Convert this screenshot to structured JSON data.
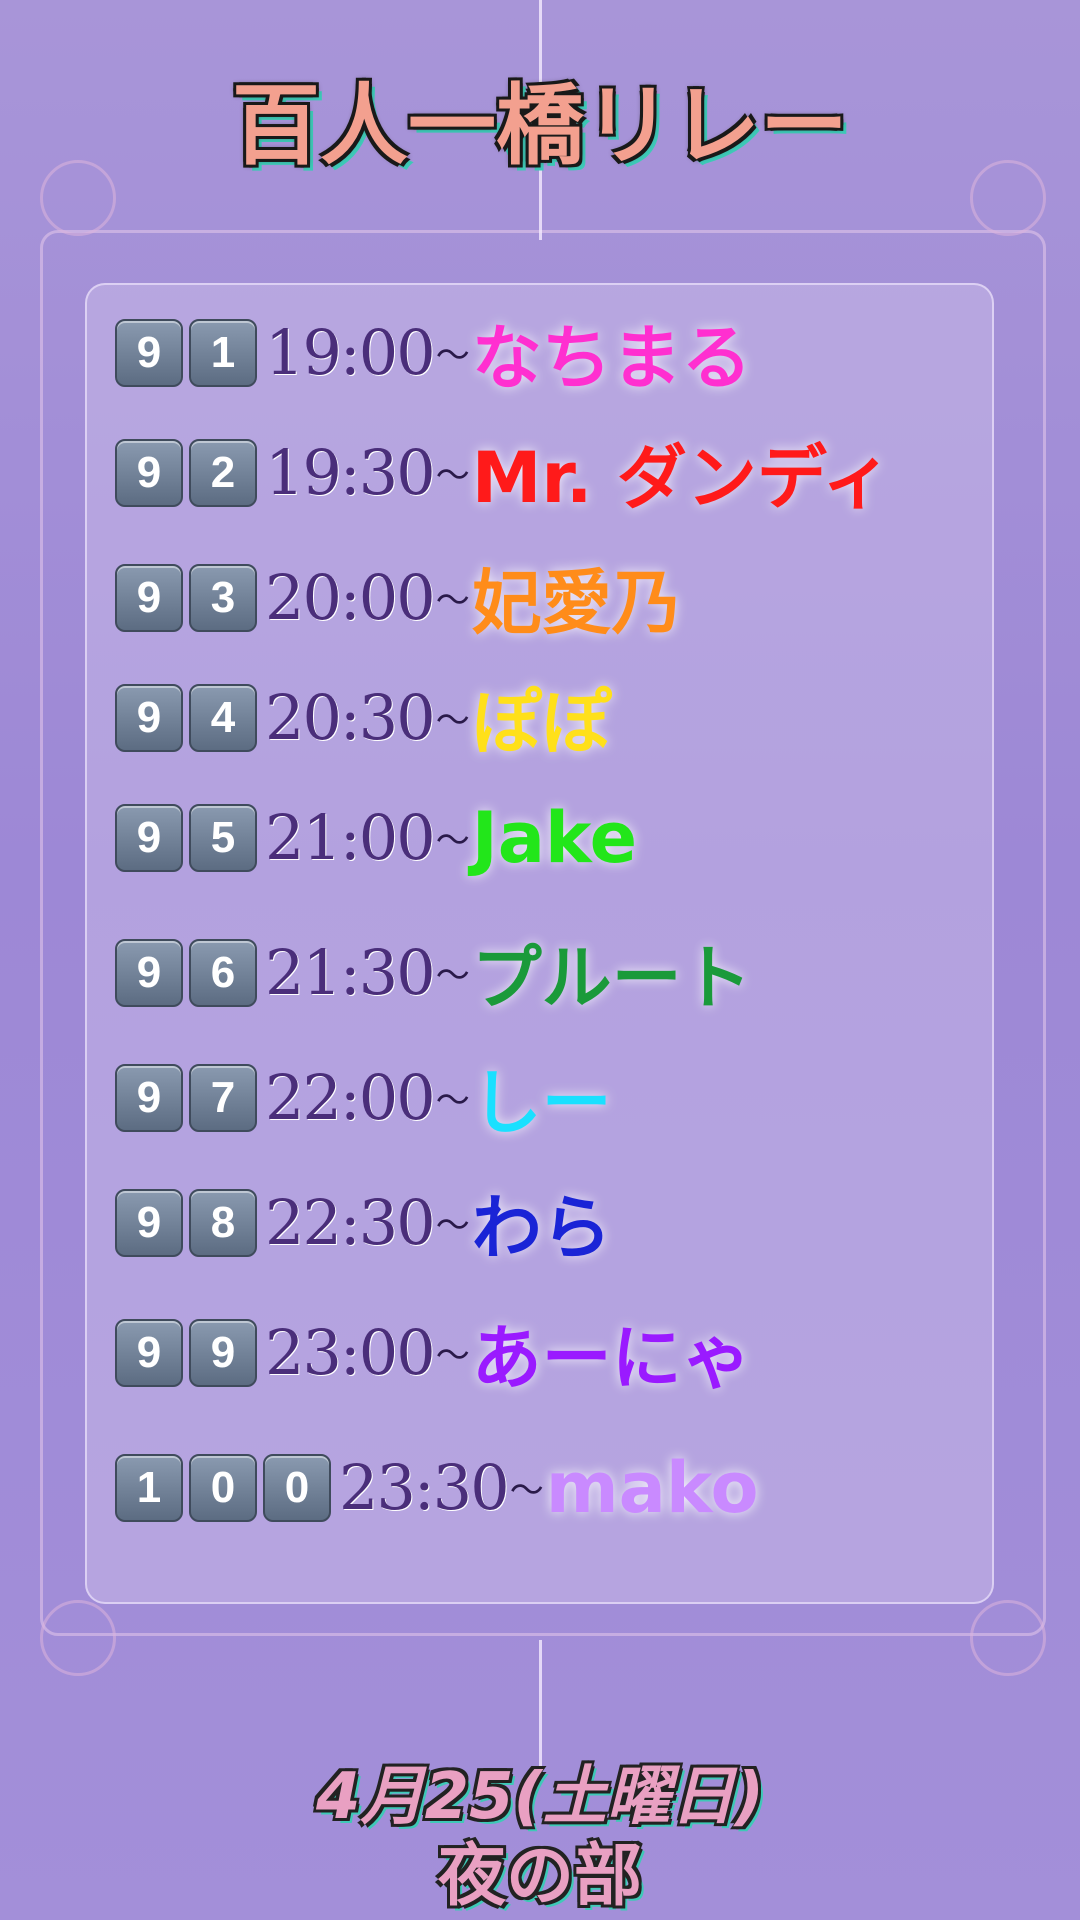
{
  "title": "百人一橋リレー",
  "footer": {
    "date": "4月25(土曜日)",
    "sub": "夜の部"
  },
  "rows": [
    {
      "num": [
        "9",
        "1"
      ],
      "time": "19:00",
      "tilde": "〜",
      "name": "なちまる",
      "color": "#ff2fd0"
    },
    {
      "num": [
        "9",
        "2"
      ],
      "time": "19:30",
      "tilde": "〜",
      "name": "Mr. ダンディ",
      "color": "#ff1a1a"
    },
    {
      "num": [
        "9",
        "3"
      ],
      "time": "20:00",
      "tilde": "〜",
      "name": "妃愛乃",
      "color": "#ff8c1a"
    },
    {
      "num": [
        "9",
        "4"
      ],
      "time": "20:30",
      "tilde": "〜",
      "name": "ぽぽ",
      "color": "#ffe01a"
    },
    {
      "num": [
        "9",
        "5"
      ],
      "time": "21:00",
      "tilde": "〜",
      "name": "Jake",
      "color": "#22e61a"
    },
    {
      "num": [
        "9",
        "6"
      ],
      "time": "21:30",
      "tilde": "〜",
      "name": "プルート",
      "color": "#1a9a3a"
    },
    {
      "num": [
        "9",
        "7"
      ],
      "time": "22:00",
      "tilde": "〜",
      "name": "しー",
      "color": "#1ae0ff"
    },
    {
      "num": [
        "9",
        "8"
      ],
      "time": "22:30",
      "tilde": "〜",
      "name": "わら",
      "color": "#1a24d6"
    },
    {
      "num": [
        "9",
        "9"
      ],
      "time": "23:00",
      "tilde": "〜",
      "name": "あーにゃ",
      "color": "#9a1aff"
    },
    {
      "num": [
        "1",
        "0",
        "0"
      ],
      "time": "23:30",
      "tilde": "〜",
      "name": "mako",
      "color": "#c98aff"
    }
  ]
}
